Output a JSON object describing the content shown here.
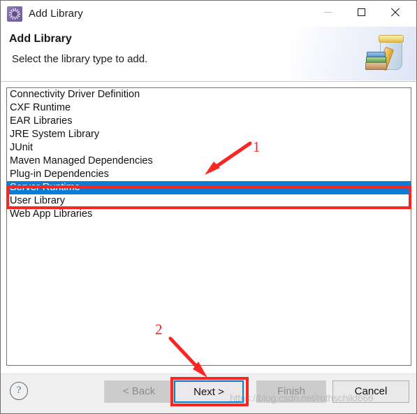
{
  "window": {
    "title": "Add Library",
    "icon": "library-gear-icon",
    "controls": {
      "minimize": "minimize-icon",
      "maximize": "maximize-icon",
      "close": "close-icon"
    }
  },
  "header": {
    "title": "Add Library",
    "description": "Select the library type to add.",
    "icon": "jar-of-books-icon"
  },
  "list": {
    "items": [
      {
        "label": "Connectivity Driver Definition",
        "selected": false
      },
      {
        "label": "CXF Runtime",
        "selected": false
      },
      {
        "label": "EAR Libraries",
        "selected": false
      },
      {
        "label": "JRE System Library",
        "selected": false
      },
      {
        "label": "JUnit",
        "selected": false
      },
      {
        "label": "Maven Managed Dependencies",
        "selected": false
      },
      {
        "label": "Plug-in Dependencies",
        "selected": false
      },
      {
        "label": "Server Runtime",
        "selected": true
      },
      {
        "label": "User Library",
        "selected": false
      },
      {
        "label": "Web App Libraries",
        "selected": false
      }
    ],
    "selected_value": "Server Runtime"
  },
  "footer": {
    "help": "?",
    "buttons": {
      "back": {
        "label": "< Back",
        "enabled": false
      },
      "next": {
        "label": "Next >",
        "enabled": true,
        "focused": true
      },
      "finish": {
        "label": "Finish",
        "enabled": false
      },
      "cancel": {
        "label": "Cancel",
        "enabled": true
      }
    }
  },
  "annotations": {
    "step_1": "1",
    "step_2": "2",
    "highlight_color": "#fb2521",
    "focus_color": "#0d7ad5",
    "selection_color": "#0c7cd5"
  },
  "watermark": "https://blog.csdn.net/rothschild666"
}
